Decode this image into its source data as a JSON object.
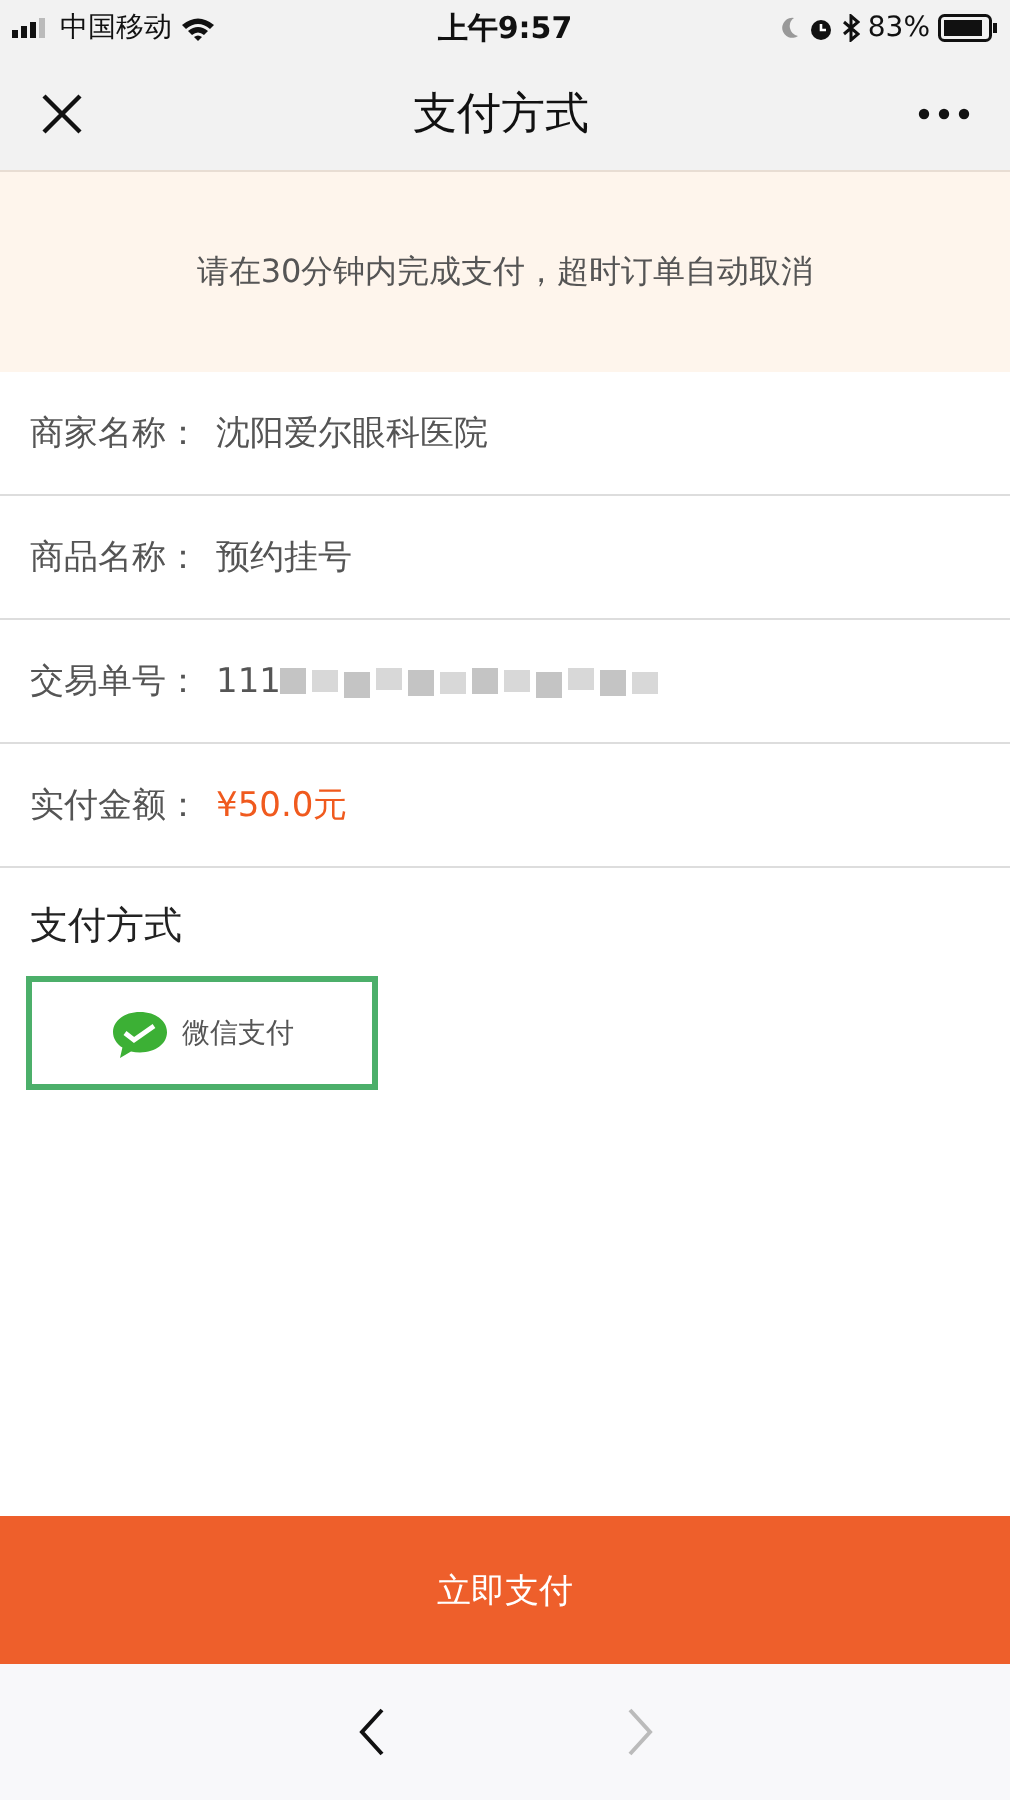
{
  "status_bar": {
    "carrier": "中国移动",
    "time": "上午9:57",
    "battery": "83%"
  },
  "nav": {
    "title": "支付方式"
  },
  "notice": "请在30分钟内完成支付，超时订单自动取消",
  "info_rows": [
    {
      "label": "商家名称：",
      "value": "沈阳爱尔眼科医院",
      "kind": "plain"
    },
    {
      "label": "商品名称：",
      "value": "预约挂号",
      "kind": "plain"
    },
    {
      "label": "交易单号：",
      "value": "111",
      "kind": "redacted"
    },
    {
      "label": "实付金额：",
      "value": "¥50.0元",
      "kind": "amount"
    }
  ],
  "payment": {
    "title": "支付方式",
    "methods": [
      {
        "label": "微信支付",
        "selected": true
      }
    ]
  },
  "pay_button": "立即支付",
  "browser_toolbar": {
    "back": {
      "disabled": false
    },
    "forward": {
      "disabled": true
    }
  }
}
